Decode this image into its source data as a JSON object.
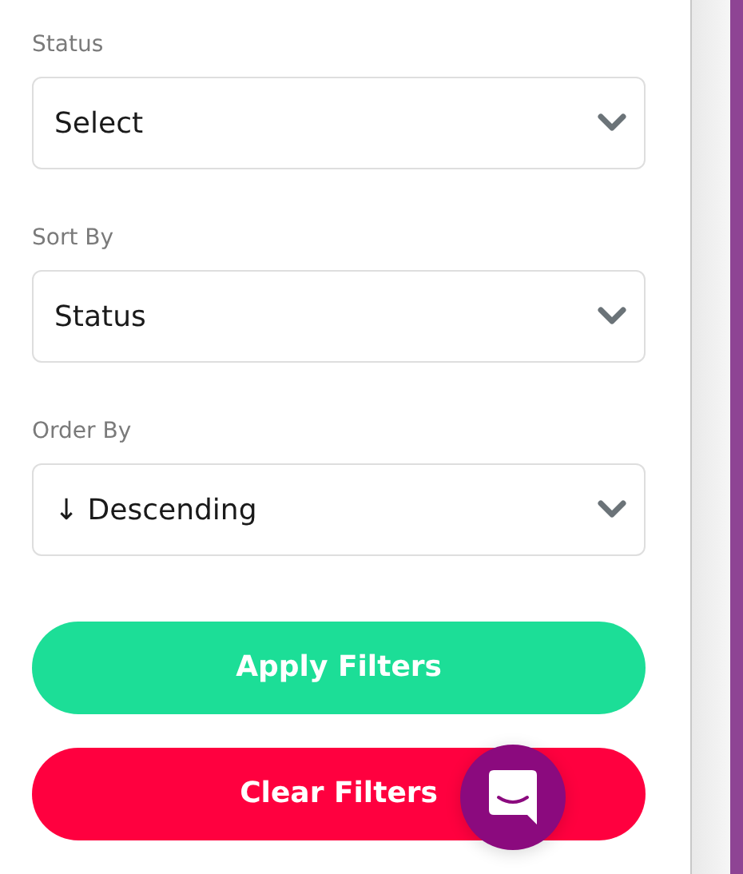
{
  "filters": [
    {
      "label": "Status",
      "value": "Select"
    },
    {
      "label": "Sort By",
      "value": "Status"
    },
    {
      "label": "Order By",
      "value": "↓ Descending"
    }
  ],
  "buttons": [
    {
      "label": "Apply Filters",
      "kind": "primary"
    },
    {
      "label": "Clear Filters",
      "kind": "danger"
    }
  ]
}
